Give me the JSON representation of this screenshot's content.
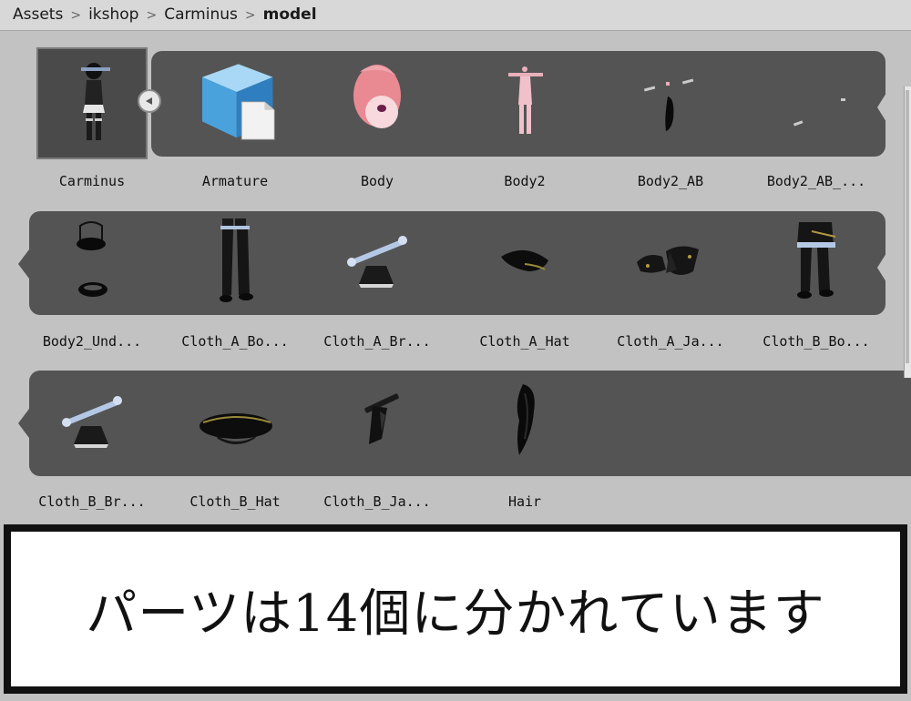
{
  "breadcrumb": {
    "items": [
      "Assets",
      "ikshop",
      "Carminus"
    ],
    "current": "model",
    "separator": ">"
  },
  "assets": [
    {
      "label": "Carminus",
      "icon": "character-prefab-icon"
    },
    {
      "label": "Armature",
      "icon": "prefab-cube-icon"
    },
    {
      "label": "Body",
      "icon": "head-mesh-icon"
    },
    {
      "label": "Body2",
      "icon": "body-mesh-icon"
    },
    {
      "label": "Body2_AB",
      "icon": "mesh-part-icon"
    },
    {
      "label": "Body2_AB_...",
      "icon": "mesh-part-icon"
    },
    {
      "label": "Body2_Und...",
      "icon": "underwear-mesh-icon"
    },
    {
      "label": "Cloth_A_Bo...",
      "icon": "boots-mesh-icon"
    },
    {
      "label": "Cloth_A_Br...",
      "icon": "skirt-mesh-icon"
    },
    {
      "label": "Cloth_A_Hat",
      "icon": "hat-mesh-icon"
    },
    {
      "label": "Cloth_A_Ja...",
      "icon": "jacket-mesh-icon"
    },
    {
      "label": "Cloth_B_Bo...",
      "icon": "boots-mesh-icon"
    },
    {
      "label": "Cloth_B_Br...",
      "icon": "skirt-mesh-icon"
    },
    {
      "label": "Cloth_B_Hat",
      "icon": "cap-mesh-icon"
    },
    {
      "label": "Cloth_B_Ja...",
      "icon": "jacket-mesh-icon"
    },
    {
      "label": "Hair",
      "icon": "hair-mesh-icon"
    }
  ],
  "caption": {
    "text": "パーツは14個に分かれています"
  },
  "colors": {
    "group_background": "#545454",
    "panel_background": "#c2c2c2",
    "caption_border": "#111111"
  }
}
